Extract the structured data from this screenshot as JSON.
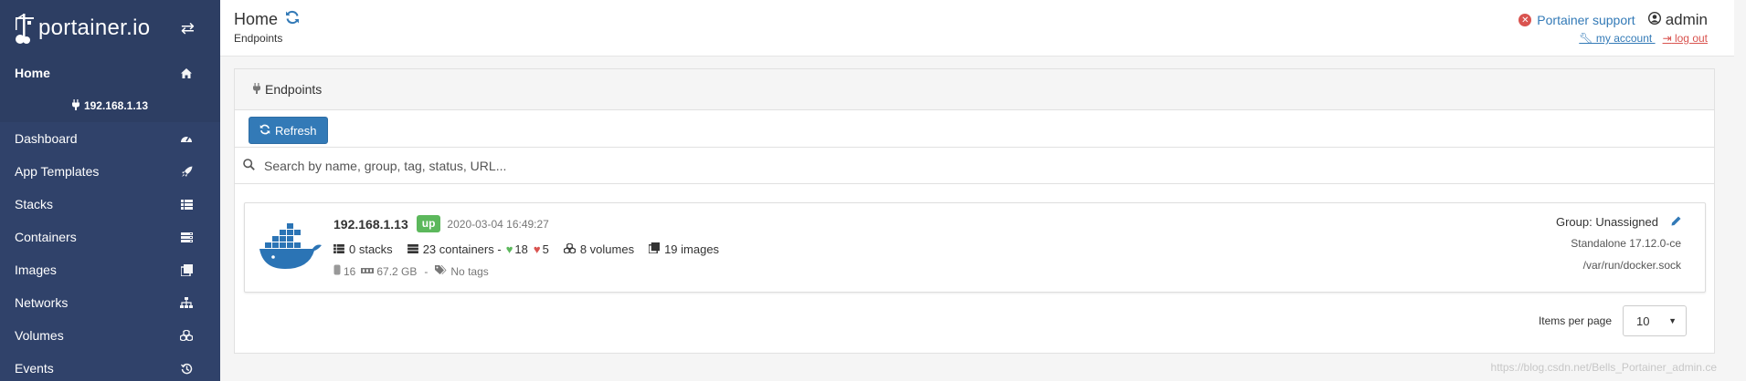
{
  "sidebar": {
    "brand": "portainer.io",
    "items": [
      {
        "label": "Home",
        "icon": "home-icon"
      },
      {
        "label": "Dashboard",
        "icon": "tachometer-icon"
      },
      {
        "label": "App Templates",
        "icon": "rocket-icon"
      },
      {
        "label": "Stacks",
        "icon": "list-icon"
      },
      {
        "label": "Containers",
        "icon": "server-icon"
      },
      {
        "label": "Images",
        "icon": "clone-icon"
      },
      {
        "label": "Networks",
        "icon": "sitemap-icon"
      },
      {
        "label": "Volumes",
        "icon": "cubes-icon"
      },
      {
        "label": "Events",
        "icon": "history-icon"
      }
    ],
    "endpoint": "192.168.1.13"
  },
  "header": {
    "title": "Home",
    "subtitle": "Endpoints",
    "support": "Portainer support",
    "user": "admin",
    "my_account": " my account ",
    "log_out": "log out"
  },
  "panel": {
    "title": "Endpoints",
    "refresh_label": "Refresh",
    "search_placeholder": "Search by name, group, tag, status, URL..."
  },
  "endpoint": {
    "name": "192.168.1.13",
    "status": "up",
    "timestamp": "2020-03-04 16:49:27",
    "stacks": "0 stacks",
    "containers": "23 containers -",
    "healthy": "18",
    "unhealthy": "5",
    "volumes": "8 volumes",
    "images": "19 images",
    "cpu": "16",
    "memory": "67.2 GB",
    "separator": "-",
    "tags": "No tags",
    "group": "Group: Unassigned",
    "version": "Standalone 17.12.0-ce",
    "url": "/var/run/docker.sock"
  },
  "pagination": {
    "label": "Items per page",
    "value": "10"
  },
  "watermark": "https://blog.csdn.net/Bells_Portainer_admin.ce",
  "colors": {
    "sidebar": "#30426a",
    "primary": "#337ab7",
    "success": "#5cb85c",
    "danger": "#d9534f"
  }
}
